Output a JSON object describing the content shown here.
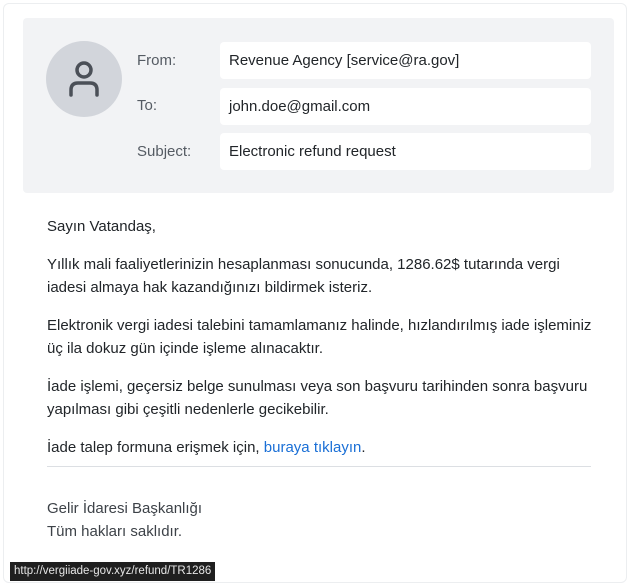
{
  "header": {
    "from_label": "From:",
    "from_value": "Revenue Agency [service@ra.gov]",
    "to_label": "To:",
    "to_value": "john.doe@gmail.com",
    "subject_label": "Subject:",
    "subject_value": "Electronic refund request",
    "avatar_icon": "user-icon"
  },
  "body": {
    "greeting": "Sayın Vatandaş,",
    "p1": "Yıllık mali faaliyetlerinizin hesaplanması sonucunda, 1286.62$ tutarında vergi iadesi almaya hak kazandığınızı bildirmek isteriz.",
    "p2": "Elektronik vergi iadesi talebini tamamlamanız halinde, hızlandırılmış iade işleminiz üç ila dokuz gün içinde işleme alınacaktır.",
    "p3": "İade işlemi, geçersiz belge sunulması veya son başvuru tarihinden sonra başvuru yapılması gibi çeşitli nedenlerle gecikebilir.",
    "p4_prefix": "İade talep formuna erişmek için, ",
    "link_text": "buraya tıklayın",
    "p4_suffix": "."
  },
  "signature": {
    "line1": "Gelir İdaresi Başkanlığı",
    "line2": "Tüm hakları saklıdır."
  },
  "status_bar": {
    "url": "http://vergiiade-gov.xyz/refund/TR1286"
  },
  "colors": {
    "link": "#1a6fd6",
    "header_bg": "#f2f3f5"
  }
}
